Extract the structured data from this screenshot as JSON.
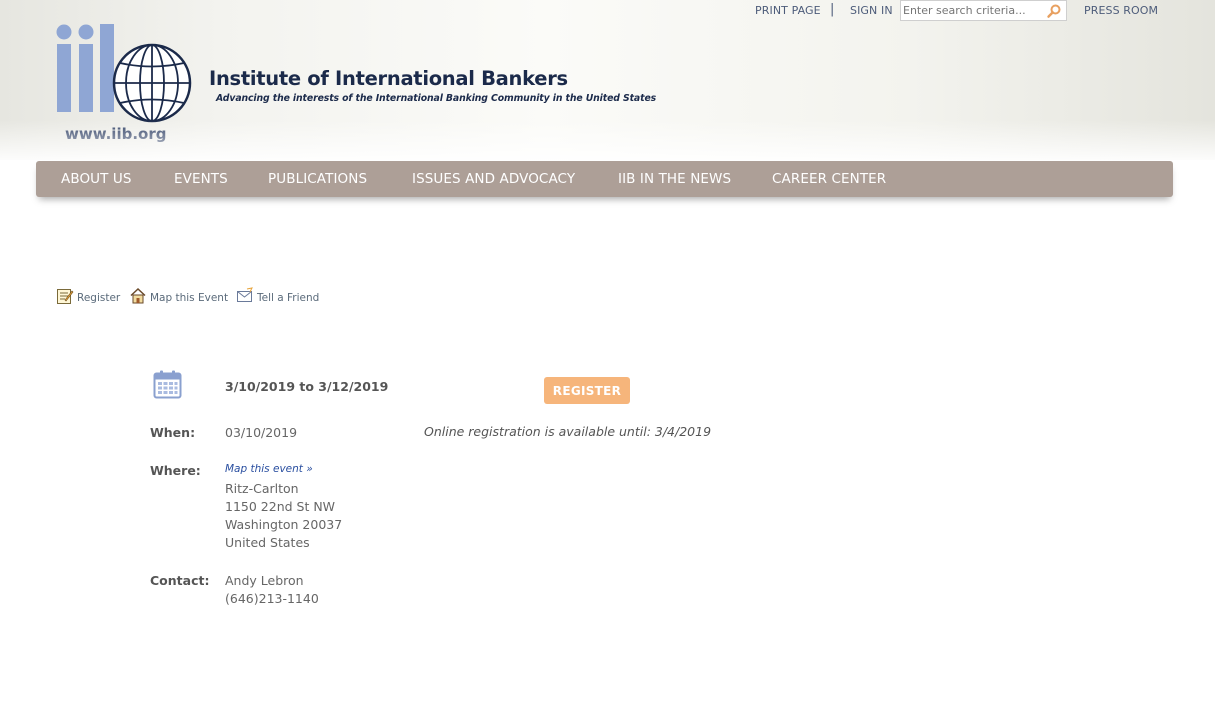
{
  "topbar": {
    "print_page": "PRINT PAGE",
    "separator": "|",
    "sign_in": "SIGN IN",
    "search_placeholder": "Enter search criteria...",
    "press_room": "PRESS ROOM"
  },
  "brand": {
    "logo_text": "iib",
    "name": "Institute of International Bankers",
    "tagline": "Advancing the interests of the International Banking Community in the United States",
    "url": "www.iib.org",
    "colors": {
      "logo_letters": "#8fa6d4",
      "text": "#1b2a4a"
    }
  },
  "nav": {
    "items": [
      {
        "label": "ABOUT US"
      },
      {
        "label": "EVENTS"
      },
      {
        "label": "PUBLICATIONS"
      },
      {
        "label": "ISSUES AND ADVOCACY"
      },
      {
        "label": "IIB IN THE NEWS"
      },
      {
        "label": "CAREER CENTER"
      }
    ],
    "color": "#ad9f97"
  },
  "actions": {
    "register": {
      "label": "Register",
      "icon": "register-icon"
    },
    "map": {
      "label": "Map this Event",
      "icon": "house-icon"
    },
    "tell": {
      "label": "Tell a Friend",
      "icon": "envelope-icon"
    }
  },
  "event": {
    "date_range": "3/10/2019 to 3/12/2019",
    "register_button": "REGISTER",
    "register_button_color": "#f6b57b",
    "when_label": "When:",
    "when_value": "03/10/2019",
    "registration_note": "Online registration is available until: 3/4/2019",
    "where_label": "Where:",
    "map_link": "Map this event »",
    "venue": "Ritz-Carlton",
    "address": "1150 22nd St NW",
    "city": "Washington 20037",
    "country": "United States",
    "contact_label": "Contact:",
    "contact_name": "Andy Lebron",
    "contact_phone": "(646)213-1140"
  }
}
